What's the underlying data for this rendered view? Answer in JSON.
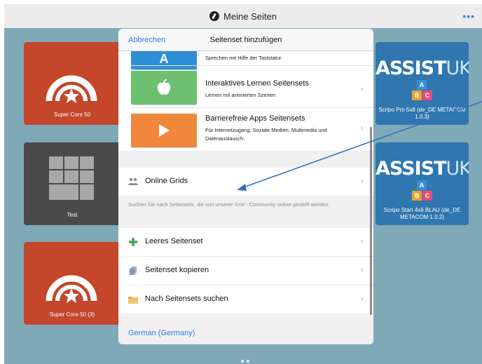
{
  "topbar": {
    "title": "Meine Seiten",
    "compass_icon": "compass-icon",
    "more_label": "•••"
  },
  "tiles": {
    "super_core_50": "Super Core 50",
    "test": "Test",
    "super_core_50_3": "Super Core 50 (3)",
    "assist_text": "ASSIST",
    "assist_uk": "UK",
    "scripo_pro": "Scripo Pro 5x8 (de_DE METACOM 1.0.3)",
    "scripo_start": "Scripo Start 4x6 BLAU (de_DE METACOM 1.0.2)",
    "block_a": "A",
    "block_b": "B",
    "block_c": "C"
  },
  "modal": {
    "cancel_label": "Abbrechen",
    "title": "Seitenset hinzufügen",
    "partial_row": {
      "description": "Sprechen mit Hilfe der Taststatur"
    },
    "rows": [
      {
        "title": "Interaktives Lernen Seitensets",
        "description": "Lernen mit animierten Szenen",
        "color": "#6cc070",
        "icon": "apple-icon"
      },
      {
        "title": "Barrierefreie Apps Seitensets",
        "description": "Für Internetzugang, Soziale Medien, Multimedia und Datenaustausch.",
        "color": "#f0873a",
        "icon": "play-icon"
      }
    ],
    "online_grids": {
      "label": "Online Grids",
      "footer": "Suchen Sie nach Seitensets, die von unserer Grid - Community online gestellt werden."
    },
    "actions": [
      {
        "label": "Leeres Seitenset",
        "icon": "plus-icon"
      },
      {
        "label": "Seitenset kopieren",
        "icon": "copy-icon"
      },
      {
        "label": "Nach Seitensets suchen",
        "icon": "folder-icon"
      }
    ],
    "language": "German (Germany)"
  },
  "colors": {
    "accent": "#3478f6",
    "tile_red": "#c4462b",
    "tile_dark": "#4a4a4a",
    "tile_blue": "#2f77ae",
    "background": "#80a9b8"
  }
}
